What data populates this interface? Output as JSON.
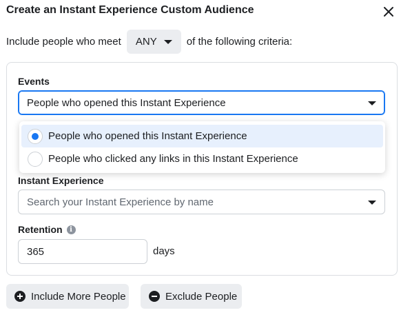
{
  "dialog": {
    "title": "Create an Instant Experience Custom Audience"
  },
  "criteria": {
    "prefix": "Include people who meet",
    "match": "ANY",
    "suffix": "of the following criteria:"
  },
  "events": {
    "label": "Events",
    "selected": "People who opened this Instant Experience",
    "options": [
      {
        "label": "People who opened this Instant Experience",
        "selected": true
      },
      {
        "label": "People who clicked any links in this Instant Experience",
        "selected": false
      }
    ]
  },
  "instant_experience": {
    "label": "Instant Experience",
    "placeholder": "Search your Instant Experience by name"
  },
  "retention": {
    "label": "Retention",
    "value": "365",
    "unit": "days"
  },
  "actions": {
    "include_more": "Include More People",
    "exclude": "Exclude People"
  },
  "colors": {
    "accent": "#1877f2",
    "selected_bg": "#e7f0fd",
    "button_bg": "#ebedf0"
  }
}
